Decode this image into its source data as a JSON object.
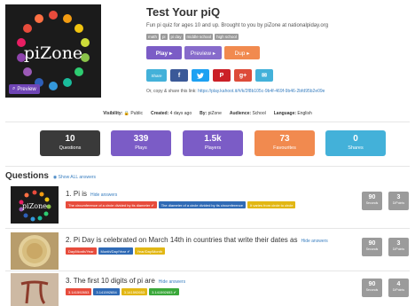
{
  "cover": {
    "logo_text": "piZone",
    "preview_label": "Preview"
  },
  "quiz": {
    "title": "Test Your piQ",
    "description": "Fun pi quiz for ages 10 and up. Brought to you by piZone at nationalpiday.org",
    "tags": [
      "math",
      "pi",
      "pi day",
      "middle school",
      "high school"
    ]
  },
  "actions": {
    "play": "Play ▸",
    "preview": "Preview ▸",
    "duplicate": "Dup ▸"
  },
  "share": {
    "share_label": "Share",
    "copy_text": "Or, copy & share this link:",
    "link": "https://play.kahoot.it/#/k/2f8b105c-9b4f-469f-9b46-2bfd95b2e09e"
  },
  "meta": {
    "visibility_label": "Visibility:",
    "visibility": "Public",
    "created_label": "Created:",
    "created": "4 days ago",
    "by_label": "By:",
    "by": "piZone",
    "audience_label": "Audience:",
    "audience": "School",
    "language_label": "Language:",
    "language": "English"
  },
  "stats": [
    {
      "value": "10",
      "label": "Questions",
      "color": "#3a3a3a"
    },
    {
      "value": "339",
      "label": "Plays",
      "color": "#7b5cc6"
    },
    {
      "value": "1.5k",
      "label": "Players",
      "color": "#7b5cc6"
    },
    {
      "value": "73",
      "label": "Favourites",
      "color": "#f18a4f"
    },
    {
      "value": "0",
      "label": "Shares",
      "color": "#43b1d9"
    }
  ],
  "questions_header": {
    "title": "Questions",
    "show_all": "Show ALL answers"
  },
  "questions": [
    {
      "text": "1. Pi is",
      "hide_label": "Hide answers",
      "answers": [
        {
          "text": "The circumference of a circle divided by its diameter ✔",
          "color": "red"
        },
        {
          "text": "The diameter of a circle divided by its circumference",
          "color": "blue"
        },
        {
          "text": "It varies from circle to circle",
          "color": "yellow"
        }
      ],
      "seconds": "90",
      "seconds_label": "Seconds",
      "points": "3",
      "points_label": "D/Points"
    },
    {
      "text": "2. Pi Day is celebrated on March 14th in countries that write their dates as",
      "hide_label": "Hide answers",
      "answers": [
        {
          "text": "Day/Month/Year",
          "color": "red"
        },
        {
          "text": "Month/Day/Year ✔",
          "color": "blue"
        },
        {
          "text": "Year/Day/Month",
          "color": "yellow"
        }
      ],
      "seconds": "90",
      "seconds_label": "Seconds",
      "points": "3",
      "points_label": "D/Points"
    },
    {
      "text": "3. The first 10 digits of pi are",
      "hide_label": "Hide answers",
      "answers": [
        {
          "text": "3.141592653",
          "color": "red"
        },
        {
          "text": "3.141592654",
          "color": "blue"
        },
        {
          "text": "3.141592653",
          "color": "yellow"
        },
        {
          "text": "3.141592653 ✔",
          "color": "green"
        }
      ],
      "seconds": "90",
      "seconds_label": "Seconds",
      "points": "4",
      "points_label": "D/Points"
    }
  ]
}
